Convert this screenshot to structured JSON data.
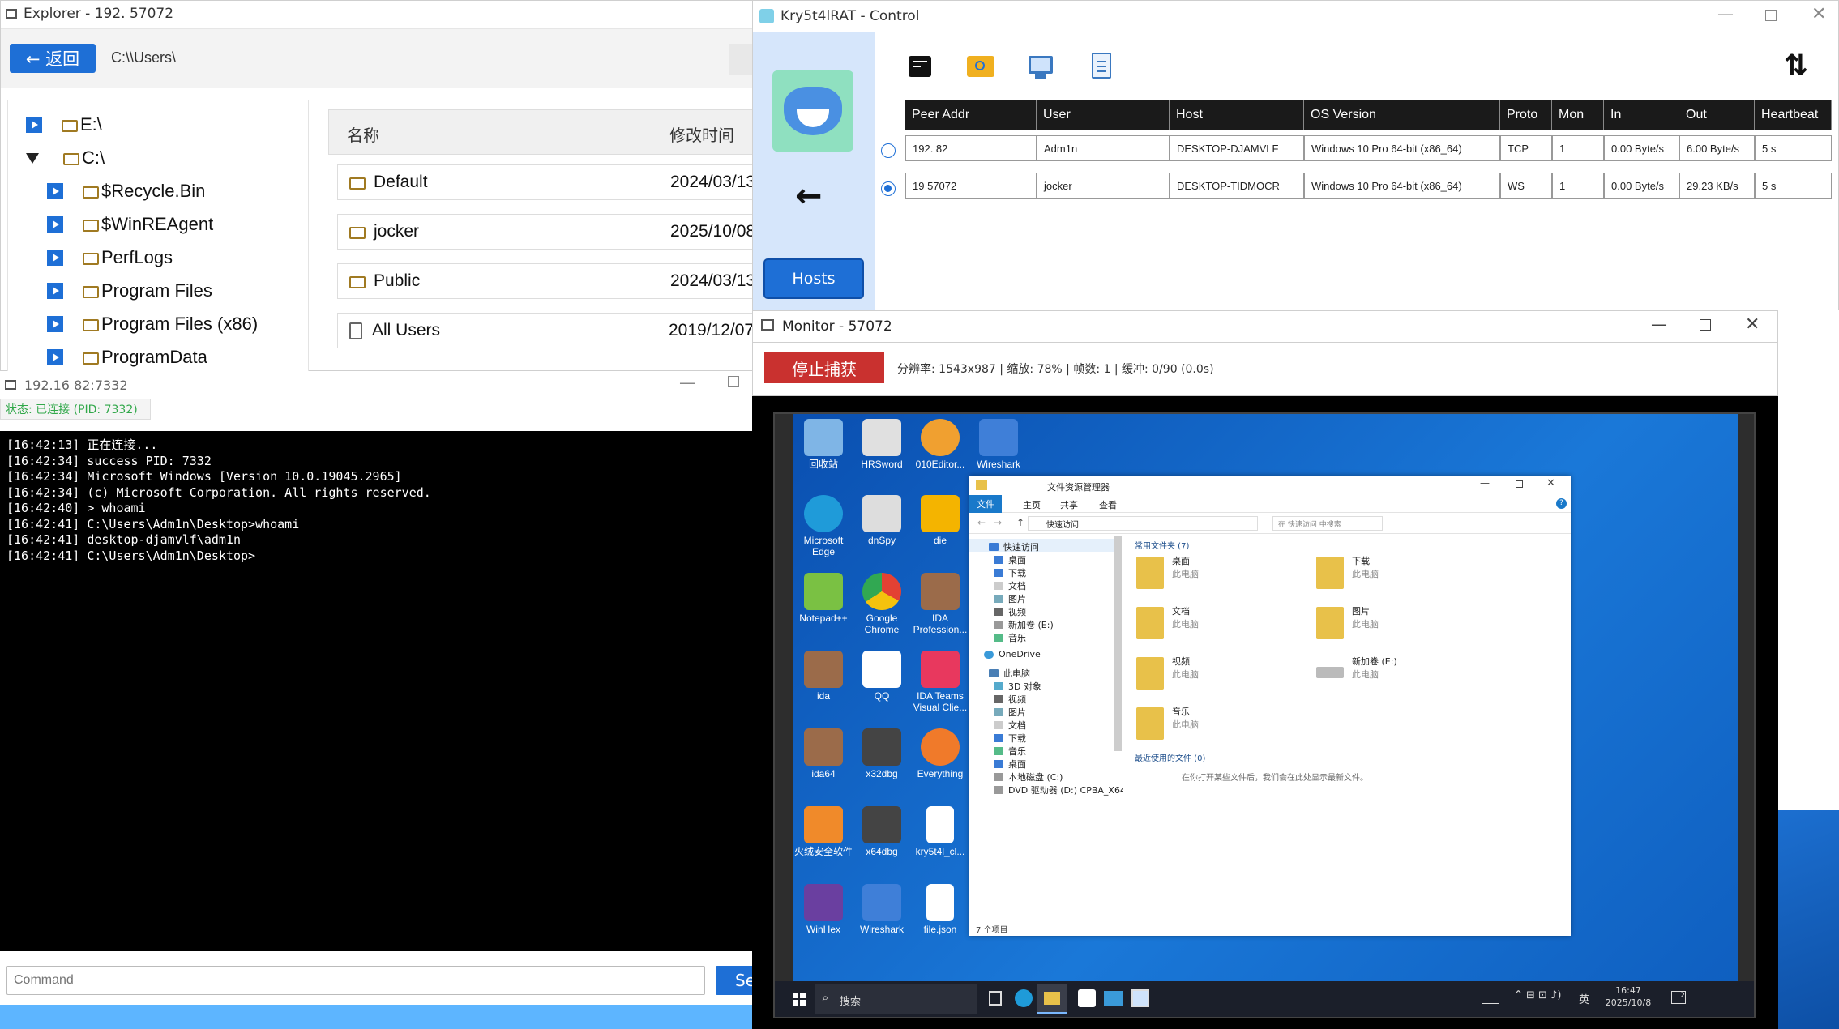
{
  "explorer": {
    "title": "Explorer - 192.        57072",
    "back_label": "← 返回",
    "path": "C:\\\\Users\\",
    "tree": [
      {
        "label": "E:\\",
        "expanded": false,
        "level": 0
      },
      {
        "label": "C:\\",
        "expanded": true,
        "level": 0
      },
      {
        "label": "$Recycle.Bin",
        "level": 1
      },
      {
        "label": "$WinREAgent",
        "level": 1
      },
      {
        "label": "PerfLogs",
        "level": 1
      },
      {
        "label": "Program Files",
        "level": 1
      },
      {
        "label": "Program Files (x86)",
        "level": 1
      },
      {
        "label": "ProgramData",
        "level": 1
      }
    ],
    "columns": {
      "name": "名称",
      "modified": "修改时间"
    },
    "files": [
      {
        "name": "Default",
        "date": "2024/03/13",
        "type": "folder"
      },
      {
        "name": "jocker",
        "date": "2025/10/08",
        "type": "folder"
      },
      {
        "name": "Public",
        "date": "2024/03/13",
        "type": "folder"
      },
      {
        "name": "All Users",
        "date": "2019/12/07",
        "type": "file"
      }
    ]
  },
  "terminal": {
    "title": "192.16        82:7332",
    "status": "状态: 已连接 (PID: 7332)",
    "lines": [
      "[16:42:13] 正在连接...",
      "[16:42:34] success PID: 7332",
      "[16:42:34] Microsoft Windows [Version 10.0.19045.2965]",
      "[16:42:34] (c) Microsoft Corporation. All rights reserved.",
      "[16:42:40] > whoami",
      "[16:42:41] C:\\Users\\Adm1n\\Desktop>whoami",
      "[16:42:41] desktop-djamvlf\\adm1n",
      "[16:42:41] C:\\Users\\Adm1n\\Desktop>"
    ],
    "command_placeholder": "Command",
    "send_label": "Se"
  },
  "control": {
    "title": "Kry5t4lRAT - Control",
    "hosts_label": "Hosts",
    "back_arrow": "←",
    "columns": [
      "Peer Addr",
      "User",
      "Host",
      "OS Version",
      "Proto",
      "Mon",
      "In",
      "Out",
      "Heartbeat"
    ],
    "rows": [
      {
        "selected": false,
        "cells": [
          "192.           82",
          "Adm1n",
          "DESKTOP-DJAMVLF",
          "Windows 10 Pro 64-bit (x86_64)",
          "TCP",
          "1",
          "0.00 Byte/s",
          "6.00 Byte/s",
          "5 s"
        ]
      },
      {
        "selected": true,
        "cells": [
          "19            57072",
          "jocker",
          "DESKTOP-TIDMOCR",
          "Windows 10 Pro 64-bit (x86_64)",
          "WS",
          "1",
          "0.00 Byte/s",
          "29.23 KB/s",
          "5 s"
        ]
      }
    ],
    "icons": [
      "terminal-icon",
      "folder-search-icon",
      "monitor-icon",
      "clipboard-icon",
      "reload-icon"
    ]
  },
  "monitor": {
    "title": "Monitor -              57072",
    "stop_label": "停止捕获",
    "stats": "分辨率: 1543x987 | 缩放: 78% | 帧数: 1 | 缓冲: 0/90 (0.0s)",
    "desktop_icons": [
      {
        "label": "回收站",
        "color": "#7fb5e6"
      },
      {
        "label": "HRSword",
        "color": "#e0e0e0"
      },
      {
        "label": "010Editor...",
        "color": "#f0a030"
      },
      {
        "label": "Wireshark",
        "color": "#3f7fd8"
      },
      {
        "label": "Microsoft Edge",
        "color": "#1f9bd9"
      },
      {
        "label": "dnSpy",
        "color": "#dddddd"
      },
      {
        "label": "die",
        "color": "#f4b400"
      },
      {
        "label": "Notepad++",
        "color": "#7ac143"
      },
      {
        "label": "Google Chrome",
        "color": "#e34133"
      },
      {
        "label": "IDA Profession...",
        "color": "#9b6b4a"
      },
      {
        "label": "ida",
        "color": "#9b6b4a"
      },
      {
        "label": "QQ",
        "color": "#ffffff"
      },
      {
        "label": "IDA Teams Visual Clie...",
        "color": "#e8385e"
      },
      {
        "label": "ida64",
        "color": "#9b6b4a"
      },
      {
        "label": "x32dbg",
        "color": "#444444"
      },
      {
        "label": "Everything",
        "color": "#f07a2a"
      },
      {
        "label": "火绒安全软件",
        "color": "#f08a2a"
      },
      {
        "label": "x64dbg",
        "color": "#444444"
      },
      {
        "label": "kry5t4l_cl...",
        "color": "#ffffff"
      },
      {
        "label": "WinHex",
        "color": "#6a3fa0"
      },
      {
        "label": "Wireshark",
        "color": "#3f7fd8"
      },
      {
        "label": "file.json",
        "color": "#ffffff"
      }
    ],
    "fe": {
      "title": "文件资源管理器",
      "tabs": [
        "文件",
        "主页",
        "共享",
        "查看"
      ],
      "address": "快速访问",
      "search_placeholder": "在 快速访问 中搜索",
      "nav": [
        "快速访问",
        "桌面",
        "下载",
        "文档",
        "图片",
        "视频",
        "新加卷 (E:)",
        "音乐",
        "OneDrive",
        "此电脑",
        "3D 对象",
        "视频",
        "图片",
        "文档",
        "下载",
        "音乐",
        "桌面",
        "本地磁盘 (C:)",
        "DVD 驱动器 (D:) CPBA_X64FRE_ZH-CN"
      ],
      "frequent_header": "常用文件夹 (7)",
      "tiles": [
        {
          "name": "桌面",
          "sub": "此电脑"
        },
        {
          "name": "下载",
          "sub": "此电脑"
        },
        {
          "name": "文档",
          "sub": "此电脑"
        },
        {
          "name": "图片",
          "sub": "此电脑"
        },
        {
          "name": "视频",
          "sub": "此电脑"
        },
        {
          "name": "新加卷 (E:)",
          "sub": "此电脑"
        },
        {
          "name": "音乐",
          "sub": "此电脑"
        }
      ],
      "recent_header": "最近使用的文件 (0)",
      "recent_empty": "在你打开某些文件后，我们会在此处显示最新文件。",
      "status": "7 个项目"
    },
    "taskbar": {
      "search": "搜索",
      "ime": "英",
      "time": "16:47",
      "date": "2025/10/8",
      "notif": "2"
    }
  },
  "colors": {
    "accent": "#1e6fd6",
    "stop_button": "#c9312f",
    "status_text": "#31a84a",
    "win_desktop": "#0f5fc0"
  }
}
